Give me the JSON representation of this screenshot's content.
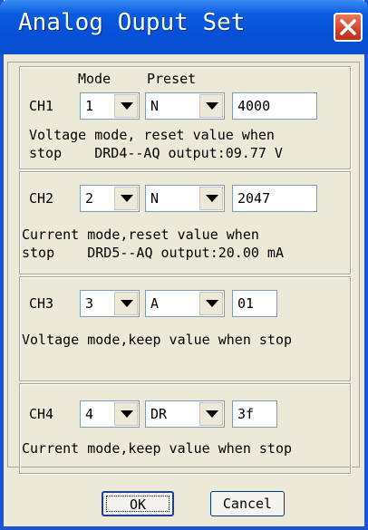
{
  "window": {
    "title": "Analog Ouput Set"
  },
  "headers": {
    "mode": "Mode",
    "preset": "Preset"
  },
  "channels": [
    {
      "label": "CH1",
      "mode": "1",
      "preset": "N",
      "value": "4000",
      "desc1": "Voltage mode, reset value when",
      "desc2": "stop    DRD4--AQ output:09.77 V"
    },
    {
      "label": "CH2",
      "mode": "2",
      "preset": "N",
      "value": "2047",
      "desc1": "Current mode,reset value when",
      "desc2": "stop    DRD5--AQ output:20.00 mA"
    },
    {
      "label": "CH3",
      "mode": "3",
      "preset": "A",
      "value": "01",
      "desc1": "Voltage mode,keep value when stop"
    },
    {
      "label": "CH4",
      "mode": "4",
      "preset": "DR",
      "value": "3f",
      "desc1": "Current mode,keep value when stop"
    }
  ],
  "buttons": {
    "ok": "OK",
    "cancel": "Cancel"
  },
  "colors": {
    "titlebar": "#0550d8",
    "face": "#ece9d8",
    "close": "#d2432a"
  }
}
